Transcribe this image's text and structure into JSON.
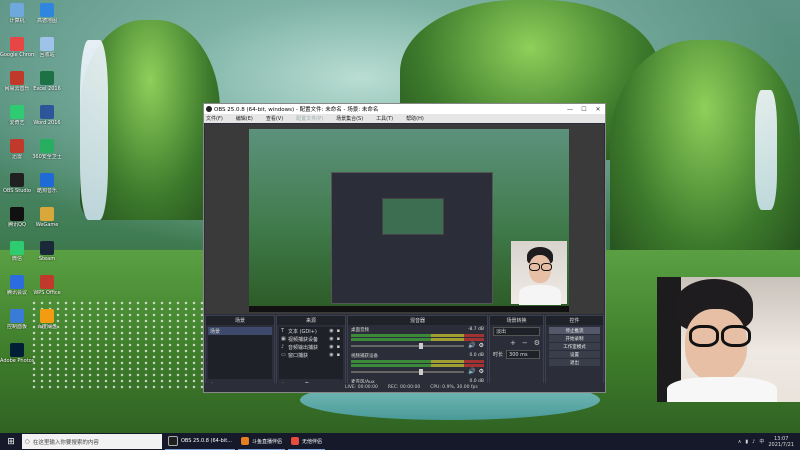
{
  "desktop": {
    "icons": [
      {
        "label": "计算机",
        "color": "#6fa8dc"
      },
      {
        "label": "高德地图",
        "color": "#2e86de"
      },
      {
        "label": "Google Chrome",
        "color": "#e84545"
      },
      {
        "label": "回收站",
        "color": "#9ec3e8"
      },
      {
        "label": "网易云音乐",
        "color": "#c0392b"
      },
      {
        "label": "Excel 2016",
        "color": "#1e7145"
      },
      {
        "label": "爱奇艺",
        "color": "#2ecc71"
      },
      {
        "label": "Word 2016",
        "color": "#2b579a"
      },
      {
        "label": "迅雷",
        "color": "#c0392b"
      },
      {
        "label": "360安全卫士",
        "color": "#27ae60"
      },
      {
        "label": "OBS Studio",
        "color": "#202020"
      },
      {
        "label": "酷狗音乐",
        "color": "#1e6bd6"
      },
      {
        "label": "腾讯QQ",
        "color": "#111111"
      },
      {
        "label": "WeGame",
        "color": "#d8a83b"
      },
      {
        "label": "微信",
        "color": "#2ecc71"
      },
      {
        "label": "Steam",
        "color": "#1b2838"
      },
      {
        "label": "腾讯会议",
        "color": "#2d6cdf"
      },
      {
        "label": "WPS Office",
        "color": "#c0392b"
      },
      {
        "label": "控制面板",
        "color": "#3a7bd5"
      },
      {
        "label": "百度网盘",
        "color": "#f39c12"
      },
      {
        "label": "Adobe Photoshop",
        "color": "#001e36"
      }
    ]
  },
  "obs": {
    "title": "OBS 25.0.8 (64-bit, windows) - 配置文件: 未命名 - 场景: 未命名",
    "menu": [
      "文件(F)",
      "编辑(E)",
      "查看(V)",
      "配置文件(P)",
      "场景集合(S)",
      "工具(T)",
      "帮助(H)"
    ],
    "docks": {
      "scenes": {
        "title": "场景",
        "items": [
          "场景"
        ]
      },
      "sources": {
        "title": "来源",
        "items": [
          {
            "icon": "T",
            "label": "文本 (GDI+)"
          },
          {
            "icon": "▣",
            "label": "视频捕获设备"
          },
          {
            "icon": "♪",
            "label": "音频输出捕获"
          },
          {
            "icon": "▭",
            "label": "窗口捕获"
          }
        ]
      },
      "mixer": {
        "title": "混音器",
        "tracks": [
          {
            "name": "桌面音频",
            "db": "-8.7 dB"
          },
          {
            "name": "视频捕获设备",
            "db": "0.0 dB"
          },
          {
            "name": "麦克风/Aux",
            "db": "0.0 dB"
          }
        ]
      },
      "transitions": {
        "title": "场景转换",
        "type": "淡出",
        "duration_label": "时长",
        "duration_value": "300 ms"
      },
      "controls": {
        "title": "控件",
        "buttons": [
          "停止推流",
          "开始录制",
          "工作室模式",
          "设置",
          "退出"
        ]
      }
    },
    "status": {
      "live": "LIVE: 00:00:00",
      "rec": "REC: 00:00:00",
      "cpu": "CPU: 0.9%, 30.00 fps"
    }
  },
  "taskbar": {
    "search_placeholder": "在这里输入你要搜索的内容",
    "apps": [
      {
        "label": "OBS 25.0.8 (64-bit...",
        "color": "#202020"
      },
      {
        "label": "斗鱼直播伴侣",
        "color": "#e67e22"
      },
      {
        "label": "无他伴侣",
        "color": "#e74c3c"
      }
    ],
    "time": "13:07",
    "date": "2021/7/21"
  }
}
